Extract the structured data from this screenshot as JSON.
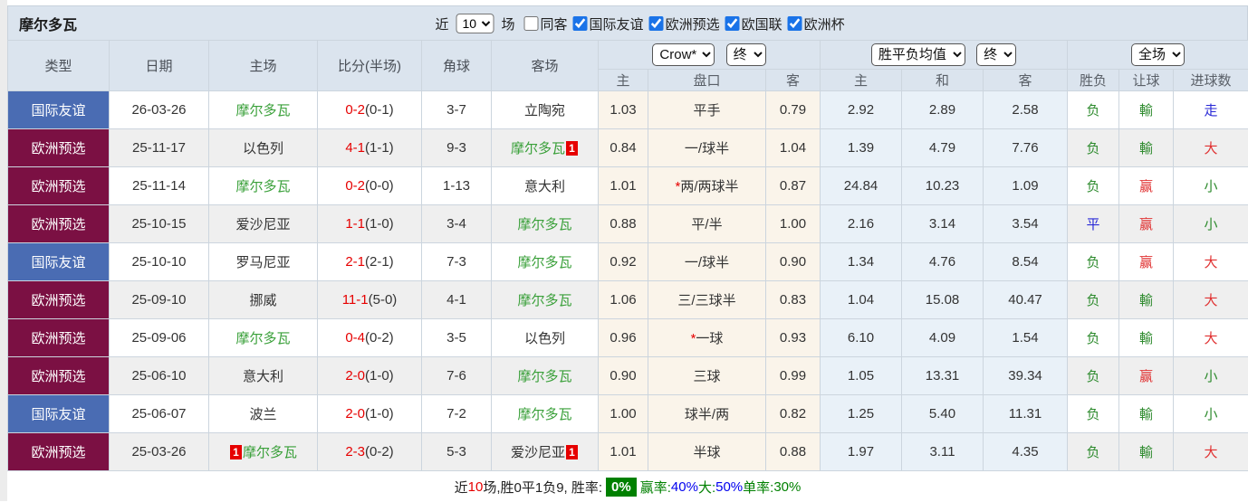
{
  "header": {
    "team_title": "摩尔多瓦",
    "recent_prefix": "近",
    "recent_value": "10",
    "recent_suffix": "场",
    "checkboxes": [
      {
        "label": "同客",
        "checked": false
      },
      {
        "label": "国际友谊",
        "checked": true
      },
      {
        "label": "欧洲预选",
        "checked": true
      },
      {
        "label": "欧国联",
        "checked": true
      },
      {
        "label": "欧洲杯",
        "checked": true
      }
    ]
  },
  "table": {
    "main_headers": [
      "类型",
      "日期",
      "主场",
      "比分(半场)",
      "角球",
      "客场"
    ],
    "group1": {
      "select1": "Crow*",
      "select2": "终"
    },
    "group2": {
      "select1": "胜平负均值",
      "select2": "终"
    },
    "group3": {
      "select1": "全场"
    },
    "sub_headers": [
      "主",
      "盘口",
      "客",
      "主",
      "和",
      "客",
      "胜负",
      "让球",
      "进球数"
    ],
    "rows": [
      {
        "type": "国际友谊",
        "type_color": "blue",
        "date": "26-03-26",
        "home": "摩尔多瓦",
        "home_green": true,
        "score": "0-2",
        "half": "(0-1)",
        "corners": "3-7",
        "away": "立陶宛",
        "away_green": false,
        "o1": "1.03",
        "handicap": "平手",
        "star": false,
        "o2": "0.79",
        "a1": "2.92",
        "a2": "2.89",
        "a3": "2.58",
        "wl": "负",
        "wl_c": "green",
        "lt": "輸",
        "lt_c": "green",
        "gl": "走",
        "gl_c": "blue"
      },
      {
        "type": "欧洲预选",
        "type_color": "maroon",
        "date": "25-11-17",
        "home": "以色列",
        "home_green": false,
        "score": "4-1",
        "half": "(1-1)",
        "corners": "9-3",
        "away": "摩尔多瓦",
        "away_green": true,
        "away_card": "1",
        "o1": "0.84",
        "handicap": "一/球半",
        "star": false,
        "o2": "1.04",
        "a1": "1.39",
        "a2": "4.79",
        "a3": "7.76",
        "wl": "负",
        "wl_c": "green",
        "lt": "輸",
        "lt_c": "green",
        "gl": "大",
        "gl_c": "red"
      },
      {
        "type": "欧洲预选",
        "type_color": "maroon",
        "date": "25-11-14",
        "home": "摩尔多瓦",
        "home_green": true,
        "score": "0-2",
        "half": "(0-0)",
        "corners": "1-13",
        "away": "意大利",
        "away_green": false,
        "o1": "1.01",
        "handicap": "两/两球半",
        "star": true,
        "o2": "0.87",
        "a1": "24.84",
        "a2": "10.23",
        "a3": "1.09",
        "wl": "负",
        "wl_c": "green",
        "lt": "赢",
        "lt_c": "red",
        "gl": "小",
        "gl_c": "green"
      },
      {
        "type": "欧洲预选",
        "type_color": "maroon",
        "date": "25-10-15",
        "home": "爱沙尼亚",
        "home_green": false,
        "score": "1-1",
        "half": "(1-0)",
        "corners": "3-4",
        "away": "摩尔多瓦",
        "away_green": true,
        "o1": "0.88",
        "handicap": "平/半",
        "star": false,
        "o2": "1.00",
        "a1": "2.16",
        "a2": "3.14",
        "a3": "3.54",
        "wl": "平",
        "wl_c": "blue",
        "lt": "赢",
        "lt_c": "red",
        "gl": "小",
        "gl_c": "green"
      },
      {
        "type": "国际友谊",
        "type_color": "blue",
        "date": "25-10-10",
        "home": "罗马尼亚",
        "home_green": false,
        "score": "2-1",
        "half": "(2-1)",
        "corners": "7-3",
        "away": "摩尔多瓦",
        "away_green": true,
        "o1": "0.92",
        "handicap": "一/球半",
        "star": false,
        "o2": "0.90",
        "a1": "1.34",
        "a2": "4.76",
        "a3": "8.54",
        "wl": "负",
        "wl_c": "green",
        "lt": "赢",
        "lt_c": "red",
        "gl": "大",
        "gl_c": "red"
      },
      {
        "type": "欧洲预选",
        "type_color": "maroon",
        "date": "25-09-10",
        "home": "挪威",
        "home_green": false,
        "score": "11-1",
        "half": "(5-0)",
        "corners": "4-1",
        "away": "摩尔多瓦",
        "away_green": true,
        "o1": "1.06",
        "handicap": "三/三球半",
        "star": false,
        "o2": "0.83",
        "a1": "1.04",
        "a2": "15.08",
        "a3": "40.47",
        "wl": "负",
        "wl_c": "green",
        "lt": "輸",
        "lt_c": "green",
        "gl": "大",
        "gl_c": "red"
      },
      {
        "type": "欧洲预选",
        "type_color": "maroon",
        "date": "25-09-06",
        "home": "摩尔多瓦",
        "home_green": true,
        "score": "0-4",
        "half": "(0-2)",
        "corners": "3-5",
        "away": "以色列",
        "away_green": false,
        "o1": "0.96",
        "handicap": "一球",
        "star": true,
        "o2": "0.93",
        "a1": "6.10",
        "a2": "4.09",
        "a3": "1.54",
        "wl": "负",
        "wl_c": "green",
        "lt": "輸",
        "lt_c": "green",
        "gl": "大",
        "gl_c": "red"
      },
      {
        "type": "欧洲预选",
        "type_color": "maroon",
        "date": "25-06-10",
        "home": "意大利",
        "home_green": false,
        "score": "2-0",
        "half": "(1-0)",
        "corners": "7-6",
        "away": "摩尔多瓦",
        "away_green": true,
        "o1": "0.90",
        "handicap": "三球",
        "star": false,
        "o2": "0.99",
        "a1": "1.05",
        "a2": "13.31",
        "a3": "39.34",
        "wl": "负",
        "wl_c": "green",
        "lt": "赢",
        "lt_c": "red",
        "gl": "小",
        "gl_c": "green"
      },
      {
        "type": "国际友谊",
        "type_color": "blue",
        "date": "25-06-07",
        "home": "波兰",
        "home_green": false,
        "score": "2-0",
        "half": "(1-0)",
        "corners": "7-2",
        "away": "摩尔多瓦",
        "away_green": true,
        "o1": "1.00",
        "handicap": "球半/两",
        "star": false,
        "o2": "0.82",
        "a1": "1.25",
        "a2": "5.40",
        "a3": "11.31",
        "wl": "负",
        "wl_c": "green",
        "lt": "輸",
        "lt_c": "green",
        "gl": "小",
        "gl_c": "green"
      },
      {
        "type": "欧洲预选",
        "type_color": "maroon",
        "date": "25-03-26",
        "home": "摩尔多瓦",
        "home_green": true,
        "home_card": "1",
        "home_card_pos": "before",
        "score": "2-3",
        "half": "(0-2)",
        "corners": "5-3",
        "away": "爱沙尼亚",
        "away_green": false,
        "away_card": "1",
        "o1": "1.01",
        "handicap": "半球",
        "star": false,
        "o2": "0.88",
        "a1": "1.97",
        "a2": "3.11",
        "a3": "4.35",
        "wl": "负",
        "wl_c": "green",
        "lt": "輸",
        "lt_c": "green",
        "gl": "大",
        "gl_c": "red"
      }
    ]
  },
  "footer": {
    "segments": [
      {
        "text": "近",
        "style": "plain"
      },
      {
        "text": "10",
        "style": "red"
      },
      {
        "text": "场,胜0平1负9, 胜率:",
        "style": "plain"
      },
      {
        "text": "0%",
        "style": "badge"
      },
      {
        "text": "赢率:",
        "style": "green"
      },
      {
        "text": "40%",
        "style": "blue"
      },
      {
        "text": " 大:",
        "style": "green"
      },
      {
        "text": "50%",
        "style": "blue"
      },
      {
        "text": " 单率:",
        "style": "green"
      },
      {
        "text": "30%",
        "style": "green"
      }
    ]
  },
  "colors": {
    "type_friendly": "#4a6cb3",
    "type_qualifier": "#7b1043",
    "team_green": "#3aa03a",
    "score_red": "#e60000",
    "result_green": "#2e8b2e",
    "result_red": "#e03131",
    "result_blue": "#2929d6",
    "badge_green": "#008000",
    "header_bg": "#dbe4ee",
    "odds_cream_bg": "#faf4ea",
    "avg_blue_bg": "#e9f1f8"
  }
}
